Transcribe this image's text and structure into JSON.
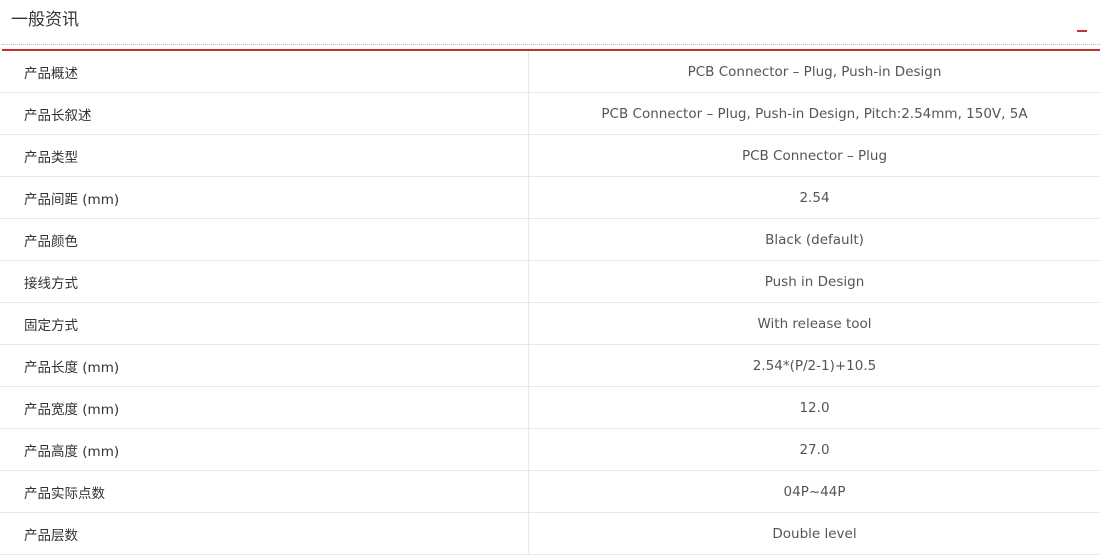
{
  "section": {
    "title": "一般资讯"
  },
  "specs": [
    {
      "label": "产品概述",
      "value": "PCB Connector – Plug, Push-in Design"
    },
    {
      "label": "产品长叙述",
      "value": "PCB Connector – Plug, Push-in Design, Pitch:2.54mm, 150V, 5A"
    },
    {
      "label": "产品类型",
      "value": "PCB Connector – Plug"
    },
    {
      "label": "产品间距 (mm)",
      "value": "2.54"
    },
    {
      "label": "产品颜色",
      "value": "Black (default)"
    },
    {
      "label": "接线方式",
      "value": "Push in Design"
    },
    {
      "label": "固定方式",
      "value": "With release tool"
    },
    {
      "label": "产品长度 (mm)",
      "value": "2.54*(P/2-1)+10.5"
    },
    {
      "label": "产品宽度 (mm)",
      "value": "12.0"
    },
    {
      "label": "产品高度 (mm)",
      "value": "27.0"
    },
    {
      "label": "产品实际点数",
      "value": "04P~44P"
    },
    {
      "label": "产品层数",
      "value": "Double level"
    }
  ],
  "colors": {
    "accent": "#c8312b",
    "border": "#e8e8e8",
    "label_text": "#333333",
    "value_text": "#555555"
  },
  "icons": {
    "collapse_toggle": "minus-icon"
  }
}
